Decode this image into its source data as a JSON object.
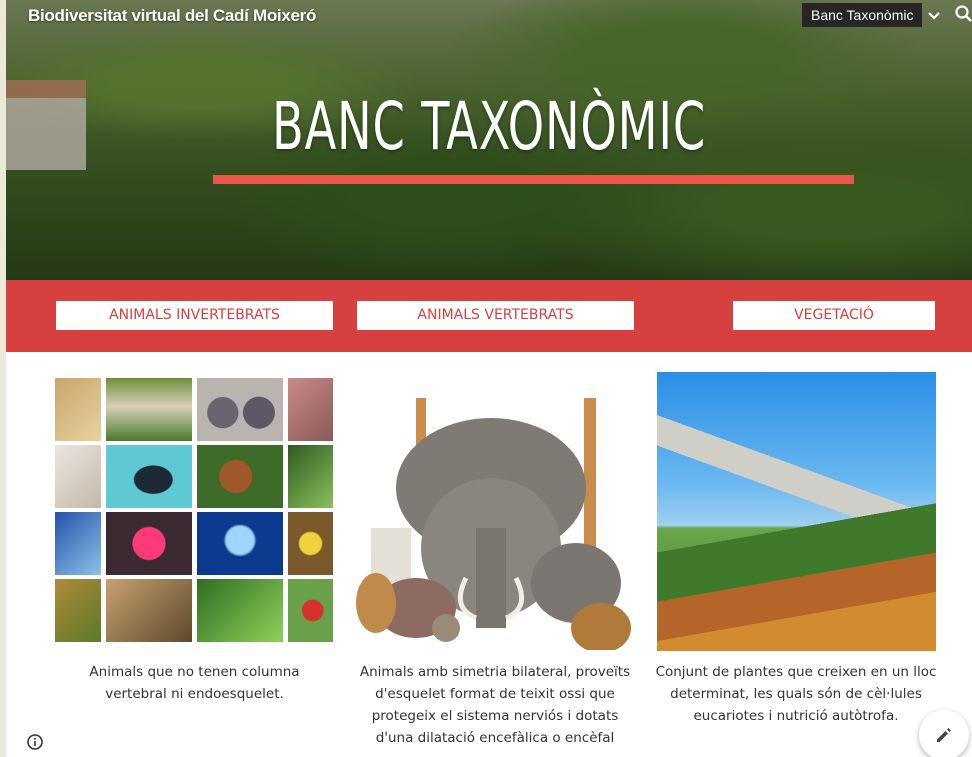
{
  "header": {
    "site_title": "Biodiversitat virtual del Cadí Moixeró",
    "nav_current": "Banc Taxonòmic",
    "chevron_icon": "chevron-down-icon",
    "search_icon": "search-icon"
  },
  "hero": {
    "heading": "BANC TAXONÒMIC",
    "accent_color": "#e9574b"
  },
  "band": {
    "color": "#d6403f",
    "buttons": [
      {
        "label": "ANIMALS INVERTEBRATS"
      },
      {
        "label": "ANIMALS VERTEBRATS"
      },
      {
        "label": "VEGETACIÓ"
      }
    ]
  },
  "cards": [
    {
      "image": "invertebrates-photo-grid",
      "description_lines": [
        "Animals que no tenen columna",
        "vertebral ni endoesquelet."
      ]
    },
    {
      "image": "vertebrate-animals-group",
      "description_lines": [
        "Animals amb simetria bilateral, proveïts",
        "d'esquelet format de teixit ossi que",
        "protegeix el sistema nerviós i dotats",
        "d'una dilatació encefàlica o encèfal"
      ]
    },
    {
      "image": "mountain-forest-landscape",
      "description_lines": [
        "Conjunt de plantes que creixen en un lloc",
        "determinat, les quals són de cèl·lules",
        "eucariotes i nutrició autòtrofa."
      ]
    }
  ],
  "footer": {
    "info_icon": "info-icon",
    "edit_icon": "pencil-icon"
  }
}
